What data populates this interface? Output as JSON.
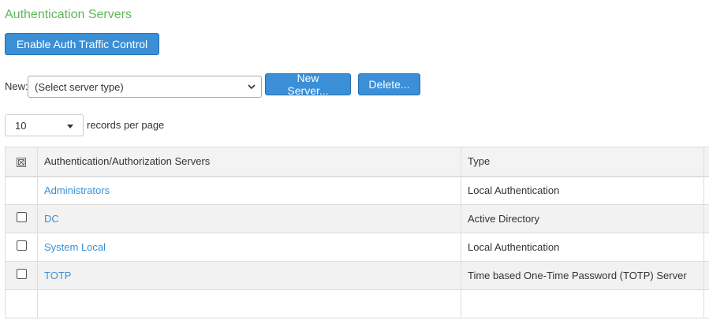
{
  "page": {
    "title": "Authentication Servers"
  },
  "toolbar": {
    "enable_label": "Enable Auth Traffic Control",
    "new_label": "New:",
    "server_type_selected": "(Select server type)",
    "new_server_label": "New Server...",
    "delete_label": "Delete..."
  },
  "pagination": {
    "page_size": "10",
    "records_per_page_label": "records per page"
  },
  "table": {
    "columns": [
      "Authentication/Authorization Servers",
      "Type"
    ],
    "rows": [
      {
        "name": "Administrators",
        "type": "Local Authentication",
        "has_checkbox": false
      },
      {
        "name": "DC",
        "type": "Active Directory",
        "has_checkbox": true
      },
      {
        "name": "System Local",
        "type": "Local Authentication",
        "has_checkbox": true
      },
      {
        "name": "TOTP",
        "type": "Time based One-Time Password (TOTP) Server",
        "has_checkbox": true
      }
    ]
  },
  "colors": {
    "title": "#5cb85c",
    "button": "#3a8fd6",
    "link": "#3a8fd6"
  }
}
